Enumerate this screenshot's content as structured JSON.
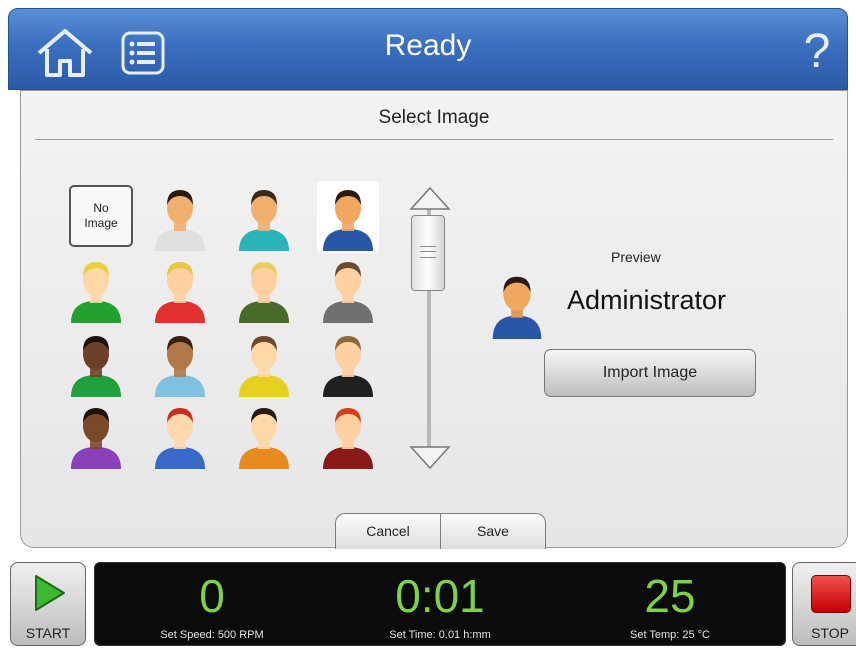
{
  "header": {
    "title": "Ready",
    "help_symbol": "?",
    "home_icon": "home-icon",
    "menu_icon": "list-icon"
  },
  "dialog": {
    "title": "Select Image",
    "no_image_line1": "No",
    "no_image_line2": "Image",
    "selected_avatar_index": 3,
    "avatars": [
      {
        "skin": "#f0b070",
        "hair": "#2a1a10",
        "shirt": "#e0e0e0"
      },
      {
        "skin": "#f0b070",
        "hair": "#3a2818",
        "shirt": "#2ab4b8"
      },
      {
        "skin": "#f0a860",
        "hair": "#2a1a10",
        "shirt": "#2a56a8"
      },
      {
        "skin": "#ffd8a8",
        "hair": "#e8d03a",
        "shirt": "#22a030"
      },
      {
        "skin": "#ffd0a0",
        "hair": "#e8c83a",
        "shirt": "#e03030"
      },
      {
        "skin": "#ffd0a0",
        "hair": "#e8d060",
        "shirt": "#4a6a2a"
      },
      {
        "skin": "#ffd0a0",
        "hair": "#6a4a2a",
        "shirt": "#707070"
      },
      {
        "skin": "#6a4028",
        "hair": "#1a0e08",
        "shirt": "#22a040"
      },
      {
        "skin": "#b07848",
        "hair": "#3a2010",
        "shirt": "#80c0e0"
      },
      {
        "skin": "#ffd8a8",
        "hair": "#6a4a2a",
        "shirt": "#e8d020"
      },
      {
        "skin": "#ffd0a0",
        "hair": "#8a6a40",
        "shirt": "#202020"
      },
      {
        "skin": "#7a4a28",
        "hair": "#1a0e08",
        "shirt": "#8a40b8"
      },
      {
        "skin": "#ffd8b0",
        "hair": "#c83020",
        "shirt": "#3a6ac8"
      },
      {
        "skin": "#ffd8a8",
        "hair": "#2a1a10",
        "shirt": "#e88a20"
      },
      {
        "skin": "#ffd0a0",
        "hair": "#d04020",
        "shirt": "#8a1a1a"
      }
    ],
    "preview_label": "Preview",
    "preview_name": "Administrator",
    "import_button": "Import Image",
    "cancel_button": "Cancel",
    "save_button": "Save"
  },
  "controls": {
    "start_label": "START",
    "stop_label": "STOP",
    "speed_value": "0",
    "speed_label": "Set Speed: 500 RPM",
    "time_value": "0:01",
    "time_label": "Set Time: 0.01 h:mm",
    "temp_value": "25",
    "temp_label": "Set Temp: 25 °C"
  },
  "colors": {
    "header_blue": "#3b6fc0",
    "readout_green": "#7fd14c",
    "stop_red": "#d00000",
    "start_green": "#3cb832"
  }
}
